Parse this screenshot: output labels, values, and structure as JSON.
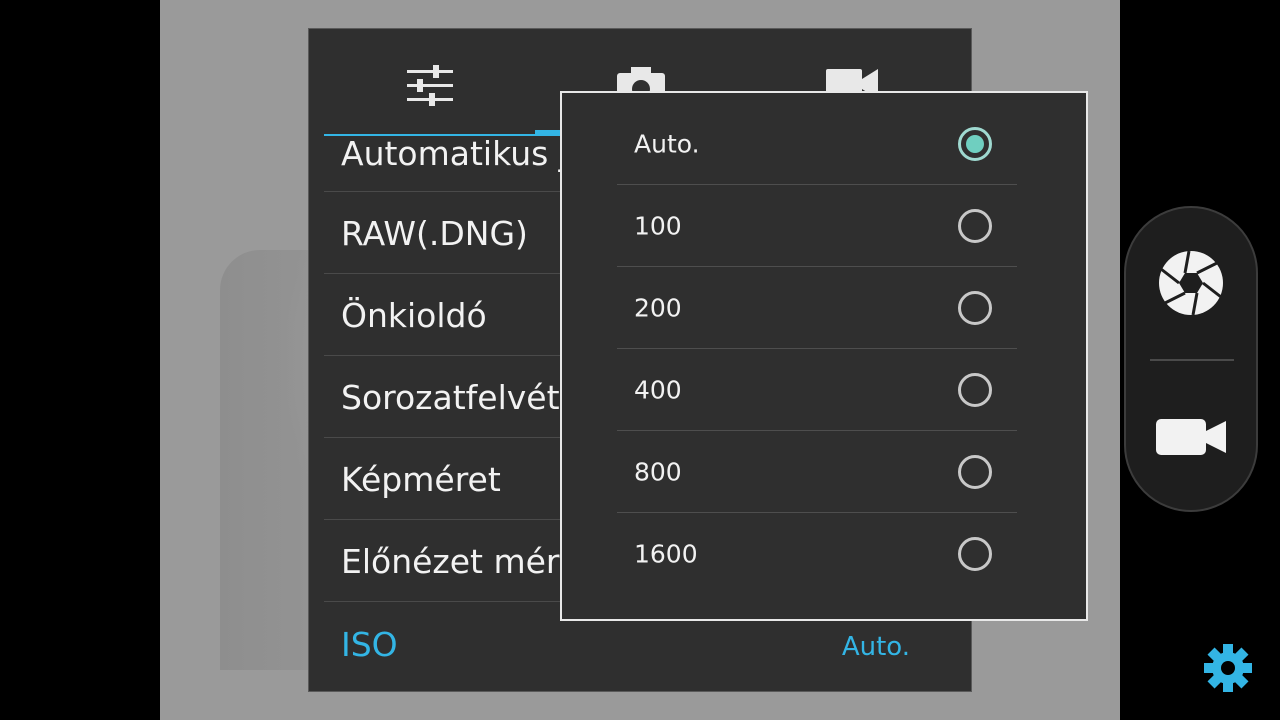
{
  "tabs": [
    {
      "name": "general",
      "icon": "sliders-icon"
    },
    {
      "name": "photo",
      "icon": "camera-icon"
    },
    {
      "name": "video",
      "icon": "video-icon"
    }
  ],
  "settings": {
    "items": [
      {
        "label": "Automatikus j"
      },
      {
        "label": "RAW(.DNG)"
      },
      {
        "label": "Önkioldó"
      },
      {
        "label": "Sorozatfelvéte"
      },
      {
        "label": "Képméret"
      },
      {
        "label": "Előnézet mére"
      },
      {
        "label": "ISO",
        "value": "Auto."
      }
    ]
  },
  "iso_popup": {
    "selected": "Auto.",
    "options": [
      {
        "label": "Auto."
      },
      {
        "label": "100"
      },
      {
        "label": "200"
      },
      {
        "label": "400"
      },
      {
        "label": "800"
      },
      {
        "label": "1600"
      }
    ]
  },
  "shutter_bar": {
    "photo_icon": "aperture-icon",
    "video_icon": "video-camera-icon"
  },
  "colors": {
    "accent": "#33b5e5",
    "radio_selected": "#6fcfc0",
    "panel_bg": "#2f2f2f",
    "gear": "#33b5e5"
  }
}
